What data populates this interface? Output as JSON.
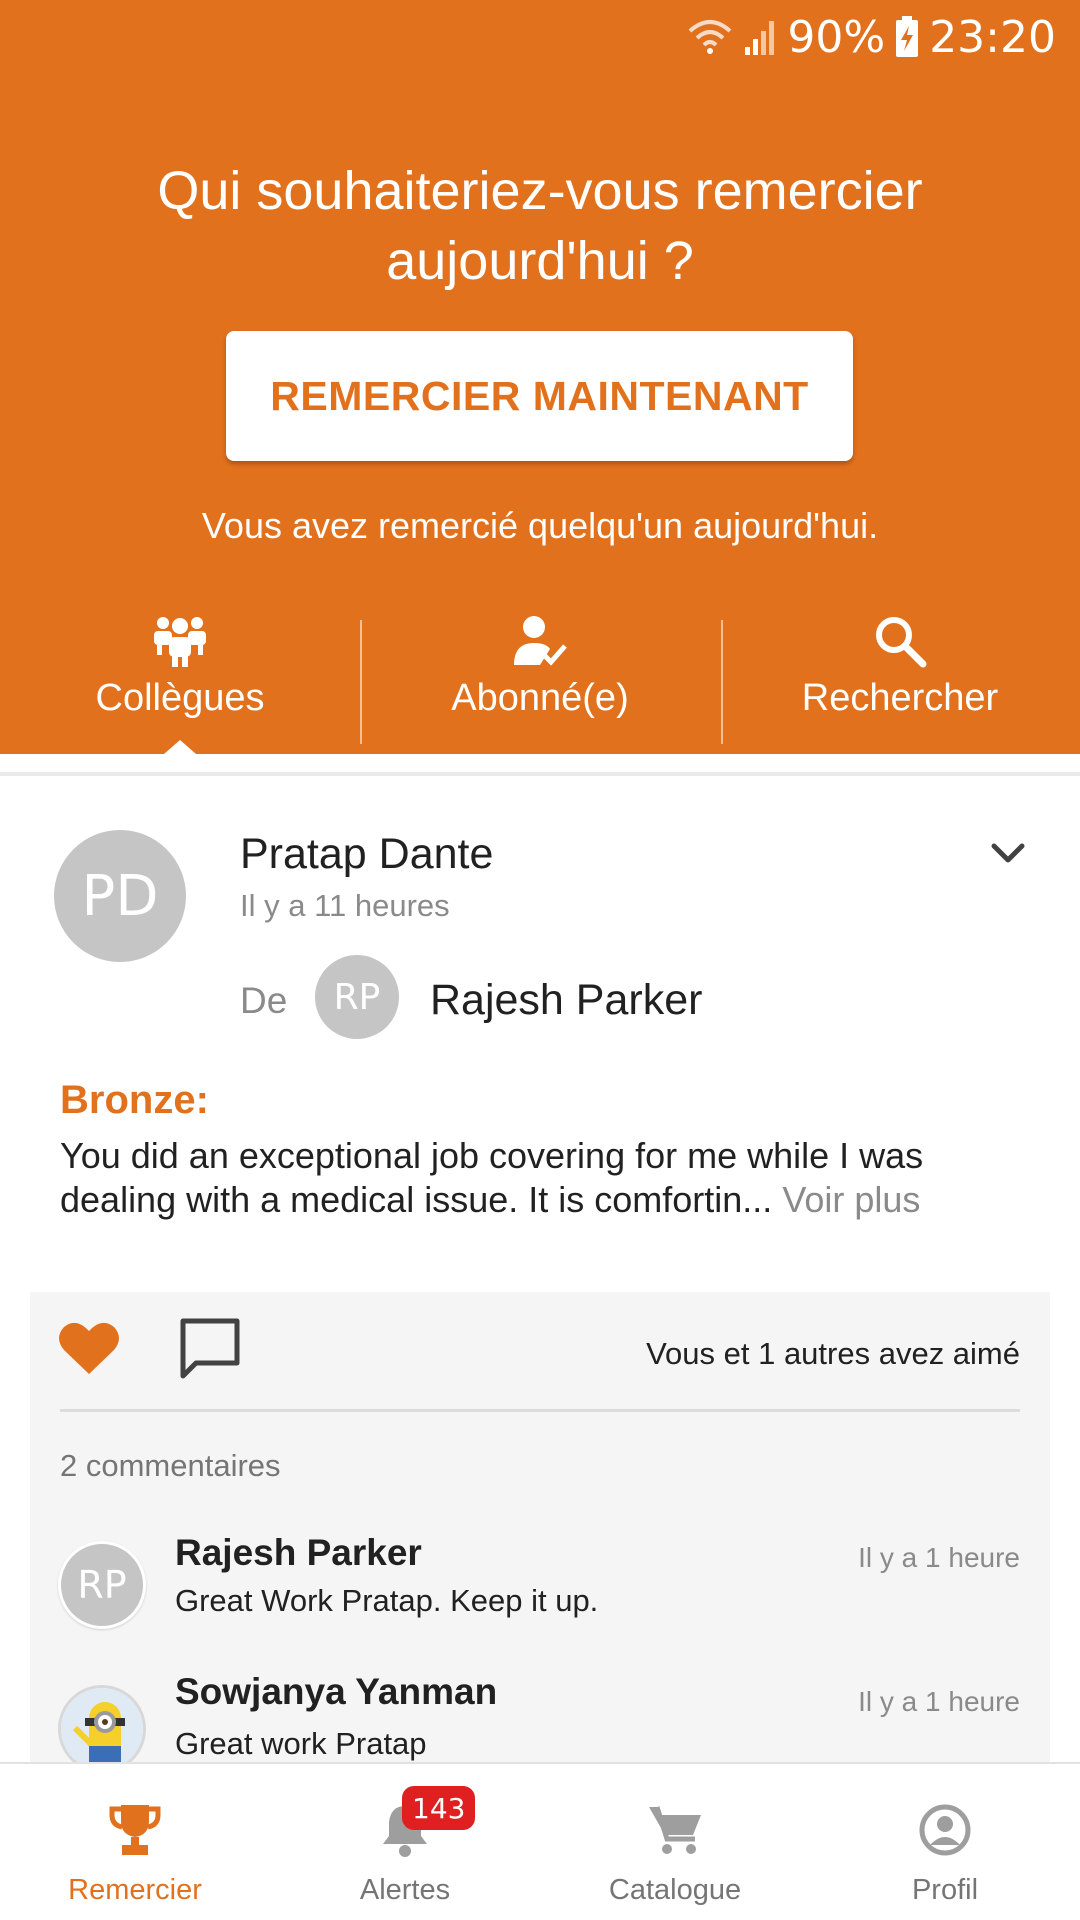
{
  "colors": {
    "brand": "#e2711d",
    "badge": "#e01f20",
    "like": "#e2711d",
    "muted": "#8a8a8a"
  },
  "status_bar": {
    "battery": "90%",
    "time": "23:20",
    "icons": [
      "wifi-icon",
      "signal-icon",
      "battery-charging-icon"
    ]
  },
  "header": {
    "title": "Qui souhaiteriez-vous remercier aujourd'hui ?",
    "cta_label": "REMERCIER MAINTENANT",
    "status_text": "Vous avez remercié quelqu'un aujourd'hui.",
    "tabs": [
      {
        "label": "Collègues",
        "icon": "colleagues-icon",
        "selected": true
      },
      {
        "label": "Abonné(e)",
        "icon": "follow-user-icon",
        "selected": false
      },
      {
        "label": "Rechercher",
        "icon": "search-icon",
        "selected": false
      }
    ]
  },
  "post": {
    "recipient_initials": "PD",
    "recipient_name": "Pratap Dante",
    "time_ago": "Il y a 11 heures",
    "from_label": "De",
    "sender_initials": "RP",
    "sender_name": "Rajesh Parker",
    "award": "Bronze:",
    "message": "You did an exceptional job covering for me while I was dealing with a medical issue. It is comfortin...",
    "see_more": "Voir plus",
    "liked": true,
    "likes_text": "Vous et 1 autres avez aimé",
    "comments_count": "2 commentaires",
    "comments": [
      {
        "initials": "RP",
        "author": "Rajesh Parker",
        "time": "Il y a 1 heure",
        "text": "Great Work Pratap. Keep it up."
      },
      {
        "initials": "",
        "author": "Sowjanya Yanman",
        "time": "Il y a 1 heure",
        "text": "Great work Pratap"
      }
    ]
  },
  "bottom_nav": [
    {
      "label": "Remercier",
      "icon": "trophy-icon",
      "active": true
    },
    {
      "label": "Alertes",
      "icon": "bell-icon",
      "active": false,
      "badge": "143"
    },
    {
      "label": "Catalogue",
      "icon": "cart-icon",
      "active": false
    },
    {
      "label": "Profil",
      "icon": "profile-icon",
      "active": false
    }
  ]
}
